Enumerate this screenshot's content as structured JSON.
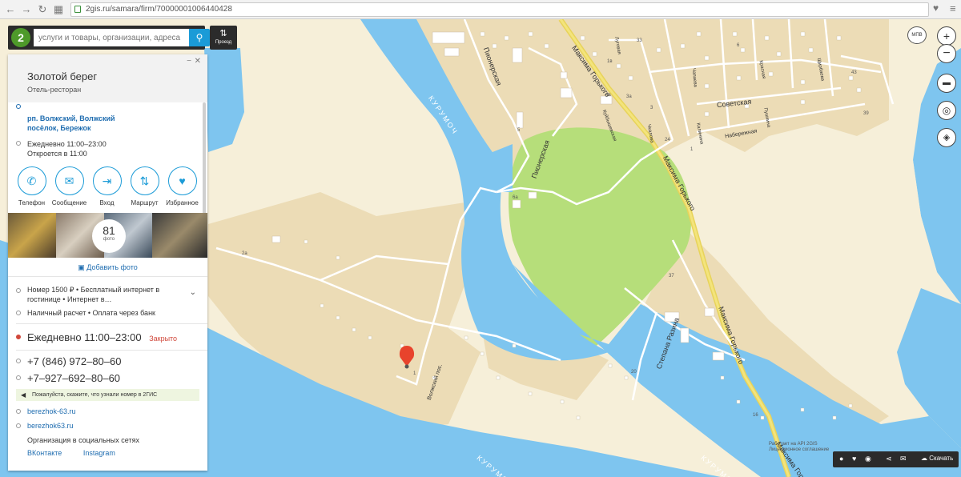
{
  "browser": {
    "url": "2gis.ru/samara/firm/70000001006440428"
  },
  "search": {
    "placeholder": "услуги и товары, организации, адреса",
    "route_label": "Проезд"
  },
  "firm": {
    "name": "Золотой берег",
    "type": "Отель-ресторан",
    "address": "рп. Волжский, Волжский посёлок, Бережок",
    "hours_line1": "Ежедневно 11:00–23:00",
    "hours_line2": "Откроется в 11:00",
    "actions": [
      {
        "label": "Телефон",
        "icon": "phone-icon"
      },
      {
        "label": "Сообщение",
        "icon": "message-icon"
      },
      {
        "label": "Вход",
        "icon": "entrance-icon"
      },
      {
        "label": "Маршрут",
        "icon": "route-icon"
      },
      {
        "label": "Избранное",
        "icon": "heart-icon"
      }
    ],
    "photo_count": "81",
    "photo_label": "фото",
    "add_photo": "Добавить фото",
    "feature1": "Номер 1500 ₽ • Бесплатный интернет в гостинице • Интернет в…",
    "feature2": "Наличный расчет • Оплата через банк",
    "hours_big": "Ежедневно 11:00–23:00",
    "closed": "Закрыто",
    "phone1": "+7 (846) 972‒80‒60",
    "phone2": "+7‒927‒692‒80‒60",
    "tip": "Пожалуйста, скажите, что узнали номер в 2ГИС",
    "site1": "berezhok-63.ru",
    "site2": "berezhok63.ru",
    "social_title": "Организация в социальных сетях",
    "social_items": [
      "ВКонтакте",
      "Instagram"
    ]
  },
  "map": {
    "labels": {
      "pionerskaya1": "Пионерская",
      "pionerskaya2": "Пионерская",
      "gorkogo1": "Максима Горького",
      "gorkogo2": "Максима Горького",
      "gorkogo3": "Максима Горького",
      "gorkogo4": "Максима Горького",
      "sovetskaya": "Советская",
      "naberezhnaya": "Набережная",
      "razina": "Степана Разина",
      "volzhskiy": "Волжский пос.",
      "kurumoch1": "КУРУМОЧ",
      "kurumoch2": "КУРУМОЧ",
      "kurumoch3": "КУРУМОЧ",
      "chapaeva": "Чапаева",
      "pushkina": "Пушкина",
      "shirbaeva": "Щирбаева",
      "kuybysheva": "Куйбышевская",
      "chkalova": "Чкалова",
      "kalinina": "Калинина",
      "krasnaya": "Красная",
      "lugovaya": "Луговая"
    },
    "numbers": [
      "33",
      "43",
      "39",
      "6",
      "5",
      "24",
      "1в",
      "6а",
      "2а",
      "37",
      "20",
      "16",
      "3",
      "1",
      "3а",
      "4а",
      "1"
    ],
    "attribution": "Работает на API 2GIS",
    "license": "Лицензионное соглашение",
    "download": "Скачать",
    "ext_label": "МПВ"
  },
  "colors": {
    "water": "#7ec5ef",
    "park": "#b6de7a",
    "land": "#f6efd9",
    "sand": "#ecdcb6",
    "accent": "#1b9bd7",
    "marker": "#e8432c"
  }
}
